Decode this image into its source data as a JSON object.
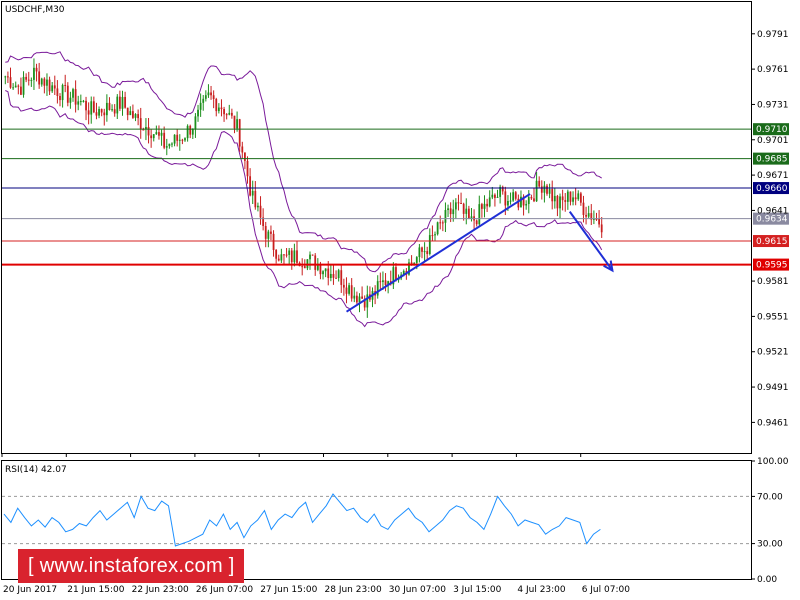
{
  "chart_data": [
    {
      "type": "candlestick",
      "title": "USDCHF,M30",
      "x_tick_labels": [
        "20 Jun 2017",
        "21 Jun 15:00",
        "22 Jun 23:00",
        "26 Jun 07:00",
        "27 Jun 15:00",
        "28 Jun 23:00",
        "30 Jun 07:00",
        "3 Jul 15:00",
        "4 Jul 23:00",
        "6 Jul 07:00"
      ],
      "y_tick_labels": [
        "0.9791",
        "0.9761",
        "0.9731",
        "0.9701",
        "0.9671",
        "0.9641",
        "0.9581",
        "0.9551",
        "0.9521",
        "0.9491",
        "0.9461"
      ],
      "ylim": [
        0.9435,
        0.9818
      ],
      "horizontal_levels": [
        {
          "value": 0.971,
          "label": "0.9710",
          "color": "#1a6b1a"
        },
        {
          "value": 0.9685,
          "label": "0.9685",
          "color": "#1a6b1a"
        },
        {
          "value": 0.966,
          "label": "0.9660",
          "color": "#00007f"
        },
        {
          "value": 0.9634,
          "label": "0.9634",
          "color": "#8a8aa0"
        },
        {
          "value": 0.9615,
          "label": "0.9615",
          "color": "#d42020"
        },
        {
          "value": 0.9595,
          "label": "0.9595",
          "color": "#e00000"
        }
      ],
      "indicator": "Bollinger Bands",
      "series": [
        {
          "values": [
            0.9755,
            0.9745,
            0.9758,
            0.9748,
            0.974,
            0.9735,
            0.9725,
            0.9728,
            0.9732,
            0.9718,
            0.971,
            0.9696,
            0.9702,
            0.9715,
            0.9738,
            0.9728,
            0.971,
            0.965,
            0.962,
            0.96,
            0.9602,
            0.9598,
            0.9592,
            0.9585,
            0.957,
            0.9565,
            0.958,
            0.959,
            0.9597,
            0.961,
            0.963,
            0.9645,
            0.963,
            0.9645,
            0.9655,
            0.9648,
            0.9652,
            0.9665,
            0.9645,
            0.9655,
            0.964,
            0.963
          ]
        }
      ],
      "trendlines": [
        {
          "from": [
            0.46,
            0.9555
          ],
          "to": [
            0.705,
            0.9655
          ],
          "color": "#1f2fd6"
        }
      ],
      "arrow": {
        "from": [
          0.758,
          0.964
        ],
        "to": [
          0.815,
          0.959
        ],
        "color": "#1f2fd6"
      }
    },
    {
      "type": "line",
      "title": "RSI(14) 42.07",
      "y_tick_labels": [
        "100.00",
        "70.00",
        "30.00",
        "0.00"
      ],
      "ylim": [
        0,
        100
      ],
      "levels": [
        70,
        30
      ],
      "series": [
        {
          "values": [
            55,
            48,
            60,
            52,
            45,
            50,
            44,
            52,
            48,
            40,
            42,
            47,
            45,
            52,
            58,
            50,
            55,
            60,
            65,
            52,
            70,
            60,
            58,
            66,
            62,
            28,
            30,
            32,
            35,
            38,
            50,
            45,
            55,
            42,
            48,
            35,
            45,
            50,
            58,
            42,
            50,
            55,
            52,
            60,
            65,
            48,
            55,
            62,
            72,
            65,
            58,
            60,
            52,
            48,
            55,
            45,
            42,
            50,
            55,
            60,
            52,
            48,
            40,
            45,
            50,
            58,
            62,
            60,
            52,
            48,
            42,
            55,
            70,
            62,
            55,
            45,
            50,
            48,
            46,
            38,
            42,
            45,
            52,
            50,
            48,
            30,
            38,
            42
          ],
          "color": "#1e90ff"
        }
      ]
    }
  ],
  "watermark": "[  www.instaforex.com ]"
}
